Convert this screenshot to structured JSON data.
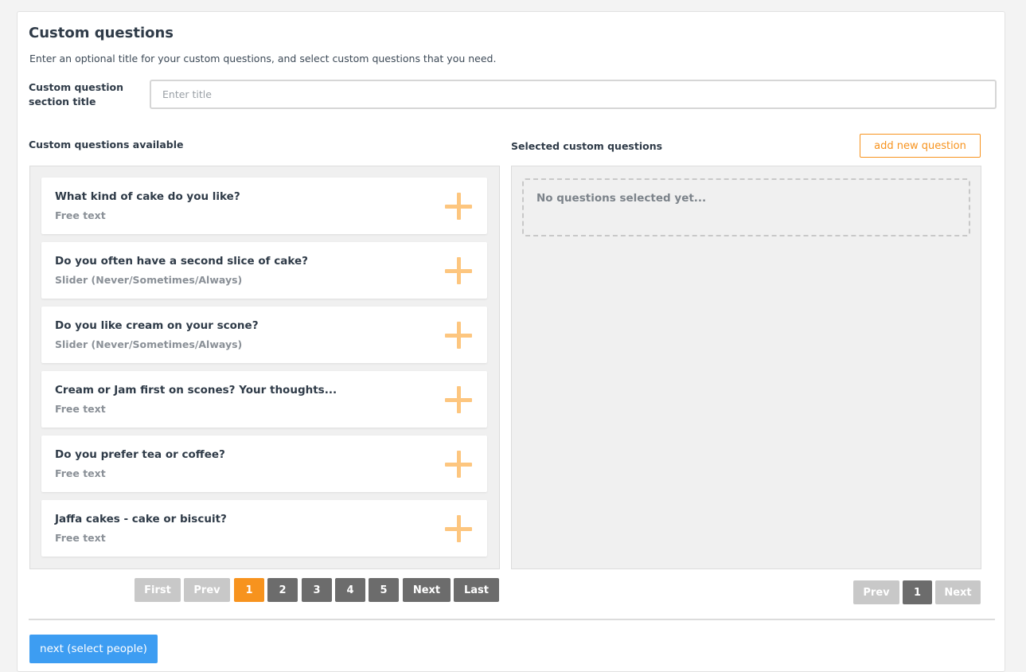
{
  "section": {
    "title": "Custom questions",
    "description": "Enter an optional title for your custom questions, and select custom questions that you need.",
    "title_field_label": "Custom question section title",
    "title_field_placeholder": "Enter title",
    "title_field_value": ""
  },
  "available": {
    "label": "Custom questions available",
    "questions": [
      {
        "title": "What kind of cake do you like?",
        "type": "Free text"
      },
      {
        "title": "Do you often have a second slice of cake?",
        "type": "Slider (Never/Sometimes/Always)"
      },
      {
        "title": "Do you like cream on your scone?",
        "type": "Slider (Never/Sometimes/Always)"
      },
      {
        "title": "Cream or Jam first on scones? Your thoughts...",
        "type": "Free text"
      },
      {
        "title": "Do you prefer tea or coffee?",
        "type": "Free text"
      },
      {
        "title": "Jaffa cakes - cake or biscuit?",
        "type": "Free text"
      }
    ],
    "pagination": {
      "first": "First",
      "prev": "Prev",
      "pages": [
        "1",
        "2",
        "3",
        "4",
        "5"
      ],
      "current_page": "1",
      "next": "Next",
      "last": "Last"
    }
  },
  "selected": {
    "label": "Selected custom questions",
    "add_button": "add new question",
    "empty_text": "No questions selected yet...",
    "pagination": {
      "prev": "Prev",
      "page": "1",
      "next": "Next"
    }
  },
  "footer": {
    "next_button": "next (select people)"
  },
  "icons": {
    "add_question": "plus-icon"
  },
  "colors": {
    "accent": "#f7931e",
    "primary": "#3d9df2",
    "plus": "#fdc67f",
    "pager_dark": "#6c6c6c",
    "pager_disabled": "#c8c8c8"
  }
}
